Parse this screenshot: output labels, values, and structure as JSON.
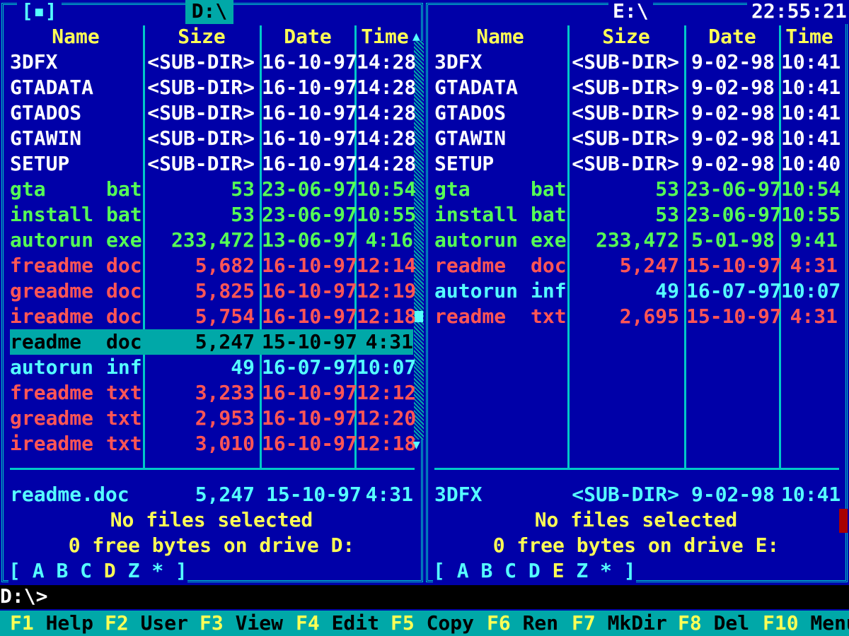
{
  "clock": "22:55:21",
  "left_panel": {
    "icon": "[▪]",
    "path": "D:\\",
    "headers": {
      "name": "Name",
      "size": "Size",
      "date": "Date",
      "time": "Time"
    },
    "rows": [
      {
        "name": "3DFX",
        "ext": "",
        "size": "<SUB-DIR>",
        "date": "16-10-97",
        "time": "14:28",
        "color": "white"
      },
      {
        "name": "GTADATA",
        "ext": "",
        "size": "<SUB-DIR>",
        "date": "16-10-97",
        "time": "14:28",
        "color": "white"
      },
      {
        "name": "GTADOS",
        "ext": "",
        "size": "<SUB-DIR>",
        "date": "16-10-97",
        "time": "14:28",
        "color": "white"
      },
      {
        "name": "GTAWIN",
        "ext": "",
        "size": "<SUB-DIR>",
        "date": "16-10-97",
        "time": "14:28",
        "color": "white"
      },
      {
        "name": "SETUP",
        "ext": "",
        "size": "<SUB-DIR>",
        "date": "16-10-97",
        "time": "14:28",
        "color": "white"
      },
      {
        "name": "gta",
        "ext": "bat",
        "size": "53",
        "date": "23-06-97",
        "time": "10:54",
        "color": "green"
      },
      {
        "name": "install",
        "ext": "bat",
        "size": "53",
        "date": "23-06-97",
        "time": "10:55",
        "color": "green"
      },
      {
        "name": "autorun",
        "ext": "exe",
        "size": "233,472",
        "date": "13-06-97",
        "time": "4:16",
        "color": "green"
      },
      {
        "name": "freadme",
        "ext": "doc",
        "size": "5,682",
        "date": "16-10-97",
        "time": "12:14",
        "color": "red"
      },
      {
        "name": "greadme",
        "ext": "doc",
        "size": "5,825",
        "date": "16-10-97",
        "time": "12:19",
        "color": "red"
      },
      {
        "name": "ireadme",
        "ext": "doc",
        "size": "5,754",
        "date": "16-10-97",
        "time": "12:18",
        "color": "red"
      },
      {
        "name": "readme",
        "ext": "doc",
        "size": "5,247",
        "date": "15-10-97",
        "time": "4:31",
        "color": "selected"
      },
      {
        "name": "autorun",
        "ext": "inf",
        "size": "49",
        "date": "16-07-97",
        "time": "10:07",
        "color": "cyan"
      },
      {
        "name": "freadme",
        "ext": "txt",
        "size": "3,233",
        "date": "16-10-97",
        "time": "12:12",
        "color": "red"
      },
      {
        "name": "greadme",
        "ext": "txt",
        "size": "2,953",
        "date": "16-10-97",
        "time": "12:20",
        "color": "red"
      },
      {
        "name": "ireadme",
        "ext": "txt",
        "size": "3,010",
        "date": "16-10-97",
        "time": "12:18",
        "color": "red"
      }
    ],
    "info_name": "readme.doc",
    "info_size": "5,247",
    "info_date": "15-10-97",
    "info_time": "4:31",
    "status": "No files selected",
    "free": "0 free bytes on drive D:",
    "drives_open": "[",
    "drives": [
      "A",
      "B",
      "C",
      "D",
      "Z",
      "*"
    ],
    "drives_close": "]",
    "active_drive": "D",
    "scroll_up": "▲",
    "scroll_down": "▼"
  },
  "right_panel": {
    "path": "E:\\",
    "headers": {
      "name": "Name",
      "size": "Size",
      "date": "Date",
      "time": "Time"
    },
    "rows": [
      {
        "name": "3DFX",
        "ext": "",
        "size": "<SUB-DIR>",
        "date": "9-02-98",
        "time": "10:41",
        "color": "white"
      },
      {
        "name": "GTADATA",
        "ext": "",
        "size": "<SUB-DIR>",
        "date": "9-02-98",
        "time": "10:41",
        "color": "white"
      },
      {
        "name": "GTADOS",
        "ext": "",
        "size": "<SUB-DIR>",
        "date": "9-02-98",
        "time": "10:41",
        "color": "white"
      },
      {
        "name": "GTAWIN",
        "ext": "",
        "size": "<SUB-DIR>",
        "date": "9-02-98",
        "time": "10:41",
        "color": "white"
      },
      {
        "name": "SETUP",
        "ext": "",
        "size": "<SUB-DIR>",
        "date": "9-02-98",
        "time": "10:40",
        "color": "white"
      },
      {
        "name": "gta",
        "ext": "bat",
        "size": "53",
        "date": "23-06-97",
        "time": "10:54",
        "color": "green"
      },
      {
        "name": "install",
        "ext": "bat",
        "size": "53",
        "date": "23-06-97",
        "time": "10:55",
        "color": "green"
      },
      {
        "name": "autorun",
        "ext": "exe",
        "size": "233,472",
        "date": "5-01-98",
        "time": "9:41",
        "color": "green"
      },
      {
        "name": "readme",
        "ext": "doc",
        "size": "5,247",
        "date": "15-10-97",
        "time": "4:31",
        "color": "red"
      },
      {
        "name": "autorun",
        "ext": "inf",
        "size": "49",
        "date": "16-07-97",
        "time": "10:07",
        "color": "cyan"
      },
      {
        "name": "readme",
        "ext": "txt",
        "size": "2,695",
        "date": "15-10-97",
        "time": "4:31",
        "color": "red"
      }
    ],
    "info_name": "3DFX",
    "info_size": "<SUB-DIR>",
    "info_date": "9-02-98",
    "info_time": "10:41",
    "status": "No files selected",
    "free": "0 free bytes on drive E:",
    "drives_open": "[",
    "drives": [
      "A",
      "B",
      "C",
      "D",
      "E",
      "Z",
      "*"
    ],
    "drives_close": "]",
    "active_drive": "E"
  },
  "command_line": {
    "prompt": "D:\\>"
  },
  "keybar": [
    {
      "num": "F1",
      "label": "Help"
    },
    {
      "num": "F2",
      "label": "User"
    },
    {
      "num": "F3",
      "label": "View"
    },
    {
      "num": "F4",
      "label": "Edit"
    },
    {
      "num": "F5",
      "label": "Copy"
    },
    {
      "num": "F6",
      "label": "Ren"
    },
    {
      "num": "F7",
      "label": "MkDir"
    },
    {
      "num": "F8",
      "label": "Del"
    },
    {
      "num": "F10",
      "label": "Menu"
    }
  ],
  "colors": {
    "background": "#0000a8",
    "frame": "#00c8c8",
    "header": "#ffff55",
    "white": "#ffffff",
    "green": "#55ff55",
    "red": "#ff5555",
    "cyan": "#55ffff",
    "selection": "#00a8a8"
  }
}
